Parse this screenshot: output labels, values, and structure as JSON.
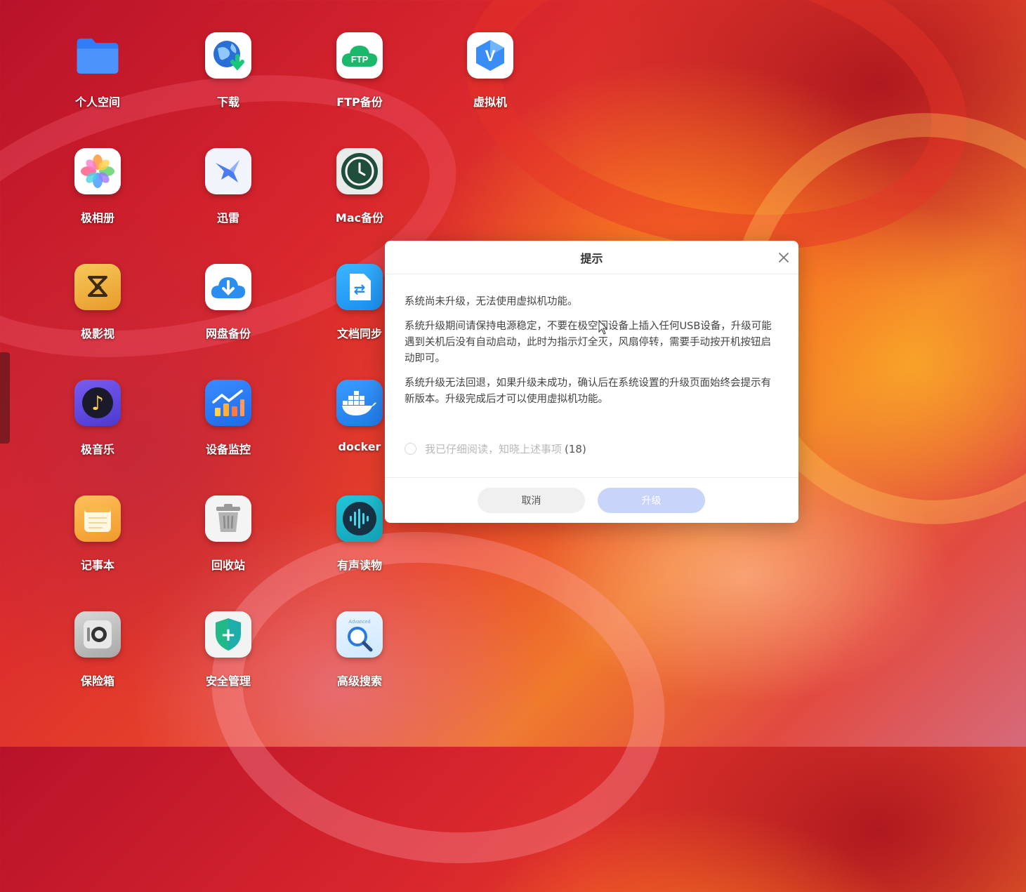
{
  "desktop": {
    "apps": [
      {
        "label": "个人空间",
        "icon": "folder-icon",
        "glyph": "",
        "color": "#2f7cf6"
      },
      {
        "label": "下载",
        "icon": "globe-download-icon",
        "glyph": "",
        "color": "#2a7be0"
      },
      {
        "label": "FTP备份",
        "icon": "ftp-cloud-icon",
        "glyph": "FTP",
        "color": "#19b86a"
      },
      {
        "label": "虚拟机",
        "icon": "virtual-machine-icon",
        "glyph": "V",
        "color": "#3a8df5"
      },
      {
        "label": "极相册",
        "icon": "photos-icon",
        "glyph": "",
        "color": "#ff7aa0"
      },
      {
        "label": "迅雷",
        "icon": "thunder-bird-icon",
        "glyph": "",
        "color": "#4a7bf0"
      },
      {
        "label": "Mac备份",
        "icon": "time-machine-icon",
        "glyph": "",
        "color": "#1f4f3c"
      },
      {
        "label": "极影视",
        "icon": "video-icon",
        "glyph": "",
        "color": "#f2b53c"
      },
      {
        "label": "网盘备份",
        "icon": "cloud-download-icon",
        "glyph": "",
        "color": "#2a8df0"
      },
      {
        "label": "文档同步",
        "icon": "document-sync-icon",
        "glyph": "⇄",
        "color": "#24a6f2"
      },
      {
        "label": "极音乐",
        "icon": "music-icon",
        "glyph": "♪",
        "color": "#6a4be0"
      },
      {
        "label": "设备监控",
        "icon": "device-monitor-icon",
        "glyph": "",
        "color": "#2a7bf0"
      },
      {
        "label": "docker",
        "icon": "docker-icon",
        "glyph": "",
        "color": "#2d8ef0"
      },
      {
        "label": "记事本",
        "icon": "notepad-icon",
        "glyph": "",
        "color": "#f6a63a"
      },
      {
        "label": "回收站",
        "icon": "trash-icon",
        "glyph": "",
        "color": "#9a9a9a"
      },
      {
        "label": "有声读物",
        "icon": "audiobook-icon",
        "glyph": "",
        "color": "#1bb6c8"
      },
      {
        "label": "保险箱",
        "icon": "safe-icon",
        "glyph": "",
        "color": "#8a8a8a"
      },
      {
        "label": "安全管理",
        "icon": "security-shield-icon",
        "glyph": "+",
        "color": "#2fbf8a"
      },
      {
        "label": "高级搜索",
        "icon": "advanced-search-icon",
        "glyph": "Advanced",
        "color": "#47a8f0"
      }
    ]
  },
  "dialog": {
    "title": "提示",
    "paragraphs": [
      "系统尚未升级，无法使用虚拟机功能。",
      "系统升级期间请保持电源稳定，不要在极空间设备上插入任何USB设备，升级可能遇到关机后没有自动启动，此时为指示灯全灭，风扇停转，需要手动按开机按钮启动即可。",
      "系统升级无法回退，如果升级未成功，确认后在系统设置的升级页面始终会提示有新版本。升级完成后才可以使用虚拟机功能。"
    ],
    "confirm_text": "我已仔细阅读，知晓上述事项",
    "countdown": "(18)",
    "cancel_label": "取消",
    "upgrade_label": "升级"
  }
}
